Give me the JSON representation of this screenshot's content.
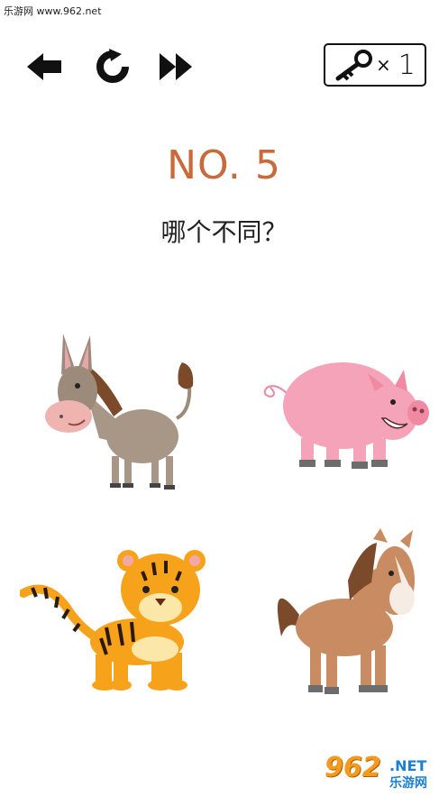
{
  "watermark": {
    "text": "乐游网 www.962.net"
  },
  "toolbar": {
    "back_icon": "back-arrow-icon",
    "restart_icon": "restart-icon",
    "skip_icon": "fast-forward-icon",
    "keys": {
      "icon": "key-icon",
      "times": "×",
      "count": "1"
    }
  },
  "level": {
    "title": "NO. 5"
  },
  "question": {
    "text": "哪个不同？"
  },
  "animals": [
    {
      "name": "donkey"
    },
    {
      "name": "pig"
    },
    {
      "name": "tiger"
    },
    {
      "name": "horse"
    }
  ],
  "logo": {
    "number": "962",
    "domain": ".NET",
    "cn": "乐游网"
  },
  "colors": {
    "title": "#c96a3a",
    "text": "#222222",
    "background": "#ffffff",
    "logo_orange": "#f39a1f",
    "logo_blue": "#1d7fd0"
  }
}
